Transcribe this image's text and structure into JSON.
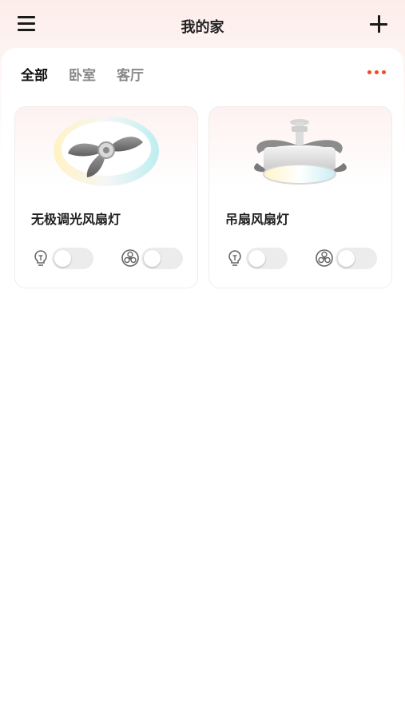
{
  "header": {
    "title": "我的家",
    "menu_icon": "hamburger-menu-icon",
    "add_icon": "plus-icon"
  },
  "tabs": [
    {
      "label": "全部",
      "active": true
    },
    {
      "label": "卧室",
      "active": false
    },
    {
      "label": "客厅",
      "active": false
    }
  ],
  "more_icon": "more-dots-icon",
  "colors": {
    "accent": "#f04a2a",
    "header_bg": "#fdecea",
    "toggle_off": "#ececec"
  },
  "devices": [
    {
      "name": "无极调光风扇灯",
      "image": "ceiling-fan-light-ring-icon",
      "light_on": false,
      "fan_on": false
    },
    {
      "name": "吊扇风扇灯",
      "image": "pendant-ceiling-fan-icon",
      "light_on": false,
      "fan_on": false
    }
  ]
}
